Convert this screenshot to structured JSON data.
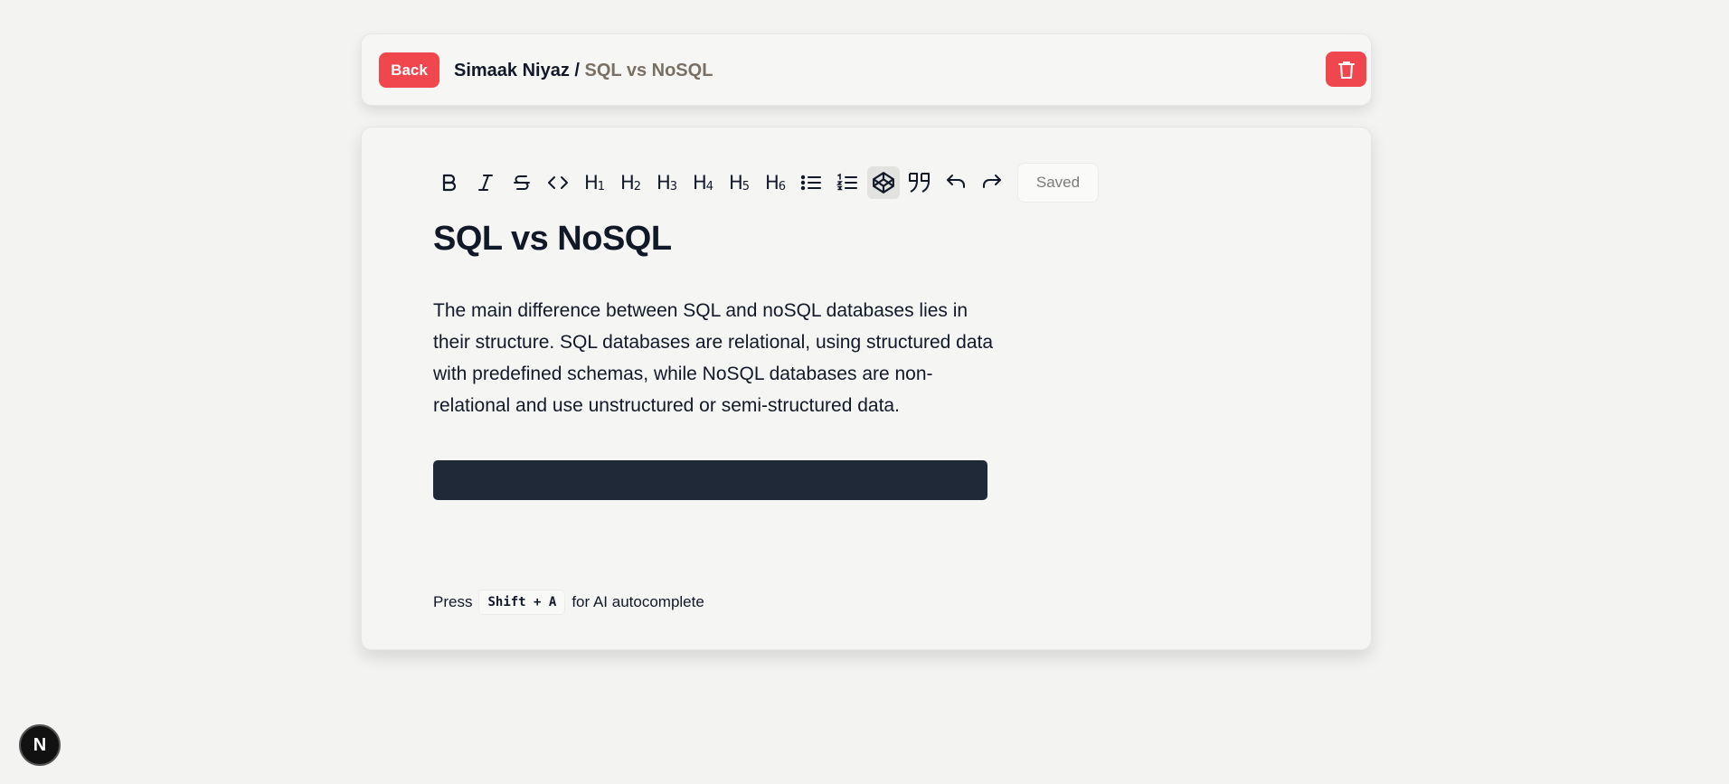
{
  "header": {
    "back_label": "Back",
    "breadcrumb_user": "Simaak Niyaz",
    "breadcrumb_separator": " / ",
    "breadcrumb_doc": "SQL vs NoSQL",
    "delete_icon": "trash-icon"
  },
  "toolbar": {
    "items": [
      {
        "name": "bold",
        "icon": "bold-icon"
      },
      {
        "name": "italic",
        "icon": "italic-icon"
      },
      {
        "name": "strikethrough",
        "icon": "strikethrough-icon"
      },
      {
        "name": "code",
        "icon": "code-icon"
      },
      {
        "name": "h1",
        "label": "H",
        "sub": "1"
      },
      {
        "name": "h2",
        "label": "H",
        "sub": "2"
      },
      {
        "name": "h3",
        "label": "H",
        "sub": "3"
      },
      {
        "name": "h4",
        "label": "H",
        "sub": "4"
      },
      {
        "name": "h5",
        "label": "H",
        "sub": "5"
      },
      {
        "name": "h6",
        "label": "H",
        "sub": "6"
      },
      {
        "name": "bullet-list",
        "icon": "bullet-list-icon"
      },
      {
        "name": "ordered-list",
        "icon": "ordered-list-icon"
      },
      {
        "name": "code-block",
        "icon": "codepen-icon",
        "active": true
      },
      {
        "name": "quote",
        "icon": "quote-icon"
      },
      {
        "name": "undo",
        "icon": "undo-icon"
      },
      {
        "name": "redo",
        "icon": "redo-icon"
      }
    ],
    "status": "Saved"
  },
  "document": {
    "title": "SQL vs NoSQL",
    "body": "The main difference between SQL and noSQL databases lies in their structure. SQL databases are relational, using structured data with predefined schemas, while NoSQL databases are non-relational and use unstructured or semi-structured data."
  },
  "hint": {
    "prefix": "Press",
    "shortcut": "Shift + A",
    "suffix": "for AI autocomplete"
  },
  "badge": {
    "label": "N"
  },
  "colors": {
    "accent": "#f0474f",
    "code_block": "#1f2937",
    "background": "#f3f3f2"
  }
}
